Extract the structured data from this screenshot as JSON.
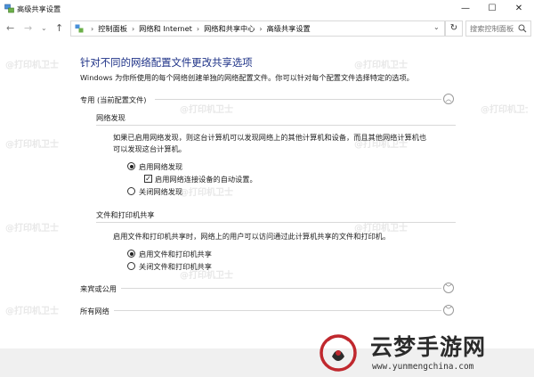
{
  "window": {
    "title": "高级共享设置",
    "minimize": "—",
    "maximize": "☐",
    "close": "✕"
  },
  "nav": {
    "back": "←",
    "forward": "→",
    "dropdown": "⌄",
    "up": "↑"
  },
  "address": {
    "crumbs": [
      "控制面板",
      "网络和 Internet",
      "网络和共享中心",
      "高级共享设置"
    ],
    "separator": "›",
    "dropdown": "⌄",
    "refresh": "↻"
  },
  "search": {
    "placeholder": "搜索控制面板"
  },
  "main": {
    "heading": "针对不同的网络配置文件更改共享选项",
    "description": "Windows 为你所使用的每个网络创建单独的网络配置文件。你可以针对每个配置文件选择特定的选项。"
  },
  "private_profile": {
    "title": "专用 (当前配置文件)",
    "network_discovery": {
      "title": "网络发现",
      "text_line1": "如果已启用网络发现，则这台计算机可以发现网络上的其他计算机和设备，而且其他网络计算机也",
      "text_line2": "可以发现这台计算机。",
      "on_label": "启用网络发现",
      "auto_setup_label": "启用网络连接设备的自动设置。",
      "off_label": "关闭网络发现"
    },
    "file_printer_sharing": {
      "title": "文件和打印机共享",
      "text": "启用文件和打印机共享时，网络上的用户可以访问通过此计算机共享的文件和打印机。",
      "on_label": "启用文件和打印机共享",
      "off_label": "关闭文件和打印机共享"
    }
  },
  "guest_public": {
    "title": "来宾或公用"
  },
  "all_networks": {
    "title": "所有网络"
  },
  "chevrons": {
    "up": "︿",
    "down": "﹀"
  },
  "watermark": {
    "text": "@打印机卫士"
  },
  "brand": {
    "name": "云梦手游网",
    "url": "www.yunmengchina.com"
  },
  "colors": {
    "heading": "#1e3287",
    "brand_red": "#c0282e"
  }
}
